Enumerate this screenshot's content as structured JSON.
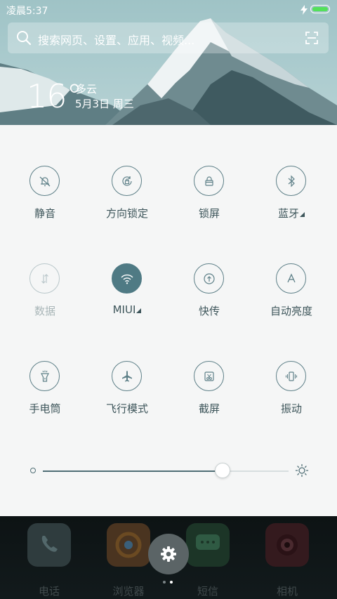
{
  "status_bar": {
    "time": "凌晨5:37",
    "battery_level": 1.0,
    "battery_color": "#53e15a"
  },
  "search": {
    "placeholder": "搜索网页、设置、应用、视频..."
  },
  "weather": {
    "temperature": "16°",
    "condition": "多云",
    "date": "5月3日 周三"
  },
  "toggles": [
    {
      "label": "静音",
      "icon": "mute-bell-icon",
      "state": "off"
    },
    {
      "label": "方向锁定",
      "icon": "rotation-lock-icon",
      "state": "off"
    },
    {
      "label": "锁屏",
      "icon": "lock-icon",
      "state": "off"
    },
    {
      "label": "蓝牙",
      "icon": "bluetooth-icon",
      "state": "off",
      "expandable": true
    },
    {
      "label": "数据",
      "icon": "mobile-data-icon",
      "state": "disabled"
    },
    {
      "label": "MIUI",
      "icon": "wifi-icon",
      "state": "on",
      "expandable": true
    },
    {
      "label": "快传",
      "icon": "quick-transfer-icon",
      "state": "off"
    },
    {
      "label": "自动亮度",
      "icon": "auto-brightness-icon",
      "state": "off"
    },
    {
      "label": "手电筒",
      "icon": "flashlight-icon",
      "state": "off"
    },
    {
      "label": "飞行模式",
      "icon": "airplane-icon",
      "state": "off"
    },
    {
      "label": "截屏",
      "icon": "screenshot-icon",
      "state": "off"
    },
    {
      "label": "振动",
      "icon": "vibrate-icon",
      "state": "off"
    }
  ],
  "brightness": {
    "level": 0.73
  },
  "dock": {
    "apps": [
      {
        "label": "电话",
        "icon": "phone-icon",
        "color": "#3a4a4d"
      },
      {
        "label": "浏览器",
        "icon": "browser-icon",
        "color": "#5a3a22"
      },
      {
        "label": "短信",
        "icon": "messages-icon",
        "color": "#1f3a2c"
      },
      {
        "label": "相机",
        "icon": "camera-icon",
        "color": "#3a1c20"
      }
    ],
    "settings_icon": "gear-icon",
    "page_indicator": {
      "pages": 2,
      "current": 2
    }
  },
  "colors": {
    "accent": "#4f7a84",
    "panel_bg": "#f5f6f6",
    "label": "#3d555a",
    "dock_bg": "#0d1314"
  }
}
